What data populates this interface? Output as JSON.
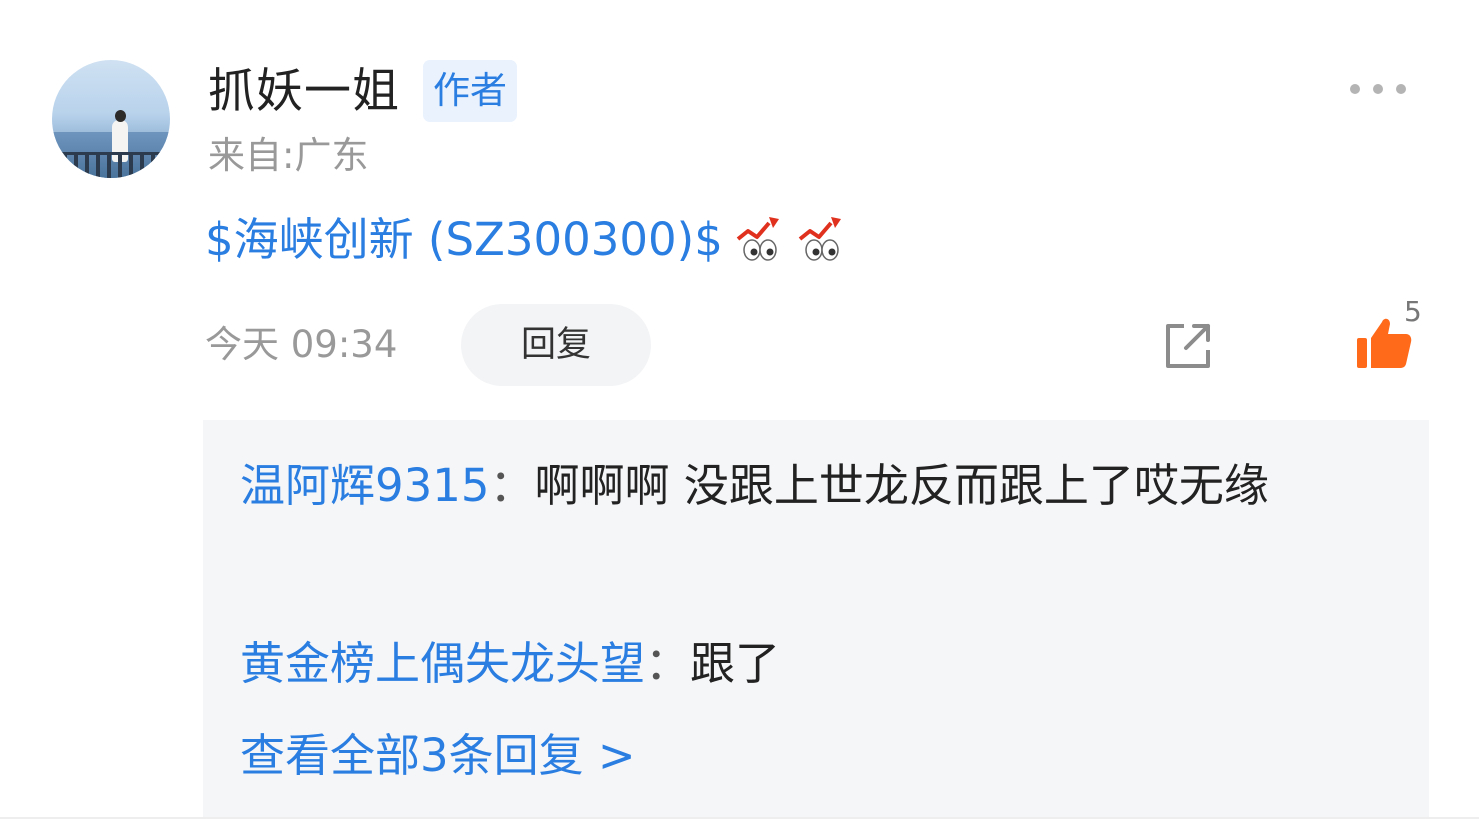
{
  "author": {
    "name": "抓妖一姐",
    "badge": "作者",
    "location": "来自:广东"
  },
  "post": {
    "stock_link": "$海峡创新 (SZ300300)$",
    "emojis": [
      "eyes-stock-up-icon",
      "eyes-stock-up-icon"
    ]
  },
  "meta": {
    "timestamp": "今天 09:34",
    "reply_label": "回复",
    "like_count": "5"
  },
  "replies": [
    {
      "user": "温阿辉9315",
      "colon": "：",
      "text": "啊啊啊 没跟上世龙反而跟上了哎无缘"
    },
    {
      "user": "黄金榜上偶失龙头望",
      "colon": "：",
      "text": "跟了"
    }
  ],
  "view_all": "查看全部3条回复 >",
  "colors": {
    "link_blue": "#2a7de1",
    "like_orange": "#ff6a1a",
    "muted_gray": "#999999",
    "reply_bg": "#f5f6f8"
  }
}
